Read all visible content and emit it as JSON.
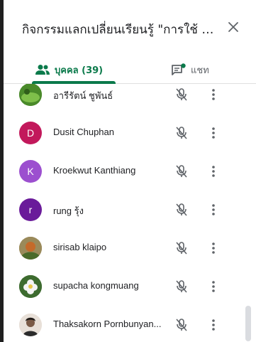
{
  "panel": {
    "title": "กิจกรรมแลกเปลี่ยนเรียนรู้ \"การใช้ O...",
    "close_icon": "close-icon"
  },
  "tabs": [
    {
      "label": "บุคคล (39)",
      "icon": "people-icon",
      "selected": true
    },
    {
      "label": "แชท",
      "icon": "chat-icon",
      "selected": false,
      "has_notification": true
    }
  ],
  "participants": [
    {
      "name": "อารีรัตน์ ชูพันธ์",
      "avatar_type": "photo",
      "avatar_color": "#4a8a2a",
      "mic": "muted"
    },
    {
      "name": "Dusit Chuphan",
      "avatar_type": "initial",
      "initial": "D",
      "avatar_color": "#c2185b",
      "mic": "muted"
    },
    {
      "name": "Kroekwut Kanthiang",
      "avatar_type": "initial",
      "initial": "K",
      "avatar_color": "#9c4fcf",
      "mic": "muted"
    },
    {
      "name": "rung รุ้ง",
      "avatar_type": "initial",
      "initial": "r",
      "avatar_color": "#6a1b9a",
      "mic": "muted"
    },
    {
      "name": "sirisab klaipo",
      "avatar_type": "photo",
      "avatar_color": "#8a6a3a",
      "mic": "muted"
    },
    {
      "name": "supacha kongmuang",
      "avatar_type": "photo",
      "avatar_color": "#3d6b2f",
      "mic": "muted"
    },
    {
      "name": "Thaksakorn Pornbunyan...",
      "avatar_type": "photo",
      "avatar_color": "#5a4636",
      "mic": "muted"
    }
  ],
  "colors": {
    "accent": "#0b7a4b",
    "text": "#202124",
    "icon": "#5f6368"
  }
}
